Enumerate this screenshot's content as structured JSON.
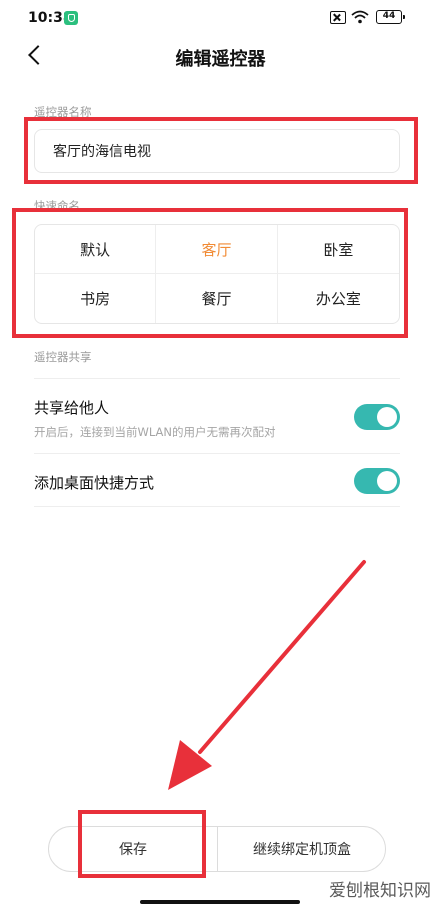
{
  "status_bar": {
    "time": "10:38",
    "battery": "44"
  },
  "nav": {
    "title": "编辑遥控器"
  },
  "name_section": {
    "label": "遥控器名称",
    "value": "客厅的海信电视"
  },
  "quick_section": {
    "label": "快速命名",
    "options": [
      "默认",
      "客厅",
      "卧室",
      "书房",
      "餐厅",
      "办公室"
    ],
    "selected": "客厅"
  },
  "share_section": {
    "label": "遥控器共享",
    "share_title": "共享给他人",
    "share_desc": "开启后，连接到当前WLAN的用户无需再次配对",
    "share_on": true,
    "desktop_title": "添加桌面快捷方式",
    "desktop_on": true
  },
  "footer": {
    "save_label": "保存",
    "bind_label": "继续绑定机顶盒"
  },
  "watermark": "爱刨根知识网",
  "colors": {
    "accent": "#f18b35",
    "toggle": "#36b8b0",
    "annotation": "#e8303a"
  }
}
